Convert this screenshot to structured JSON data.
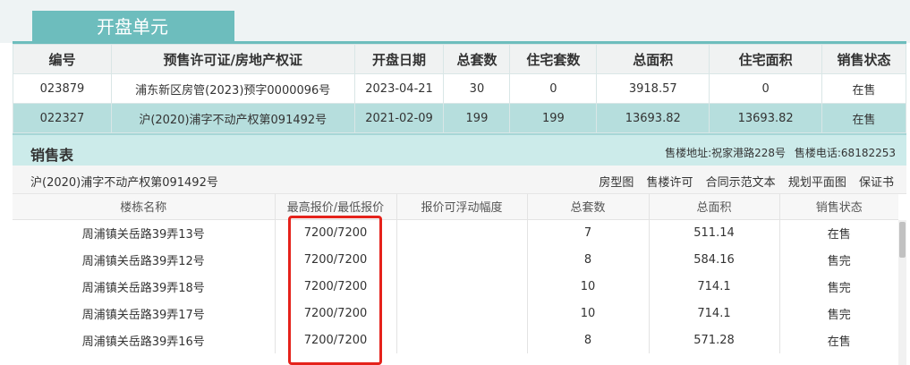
{
  "tab": {
    "title": "开盘单元"
  },
  "summary": {
    "headers": [
      "编号",
      "预售许可证/房地产权证",
      "开盘日期",
      "总套数",
      "住宅套数",
      "总面积",
      "住宅面积",
      "销售状态"
    ],
    "rows": [
      [
        "023879",
        "浦东新区房管(2023)预字0000096号",
        "2023-04-21",
        "30",
        "0",
        "3918.57",
        "0",
        "在售"
      ],
      [
        "022327",
        "沪(2020)浦字不动产权第091492号",
        "2021-02-09",
        "199",
        "199",
        "13693.82",
        "13693.82",
        "在售"
      ]
    ]
  },
  "sales": {
    "title": "销售表",
    "address_label": "售楼地址:",
    "address": "祝家港路228号",
    "phone_label": "售楼电话:",
    "phone": "68182253",
    "cert_number": "沪(2020)浦字不动产权第091492号",
    "links": [
      "房型图",
      "售楼许可",
      "合同示范文本",
      "规划平面图",
      "保证书"
    ],
    "headers": [
      "楼栋名称",
      "最高报价/最低报价",
      "报价可浮动幅度",
      "总套数",
      "总面积",
      "销售状态"
    ],
    "rows": [
      [
        "周浦镇关岳路39弄13号",
        "7200/7200",
        "",
        "7",
        "511.14",
        "在售"
      ],
      [
        "周浦镇关岳路39弄12号",
        "7200/7200",
        "",
        "8",
        "584.16",
        "售完"
      ],
      [
        "周浦镇关岳路39弄18号",
        "7200/7200",
        "",
        "10",
        "714.1",
        "售完"
      ],
      [
        "周浦镇关岳路39弄17号",
        "7200/7200",
        "",
        "10",
        "714.1",
        "售完"
      ],
      [
        "周浦镇关岳路39弄16号",
        "7200/7200",
        "",
        "8",
        "571.28",
        "在售"
      ]
    ]
  },
  "colors": {
    "accent": "#6dbdbd",
    "on_sale": "#1aa51a",
    "sold_out": "#e0201e",
    "highlight": "#e5221b"
  }
}
